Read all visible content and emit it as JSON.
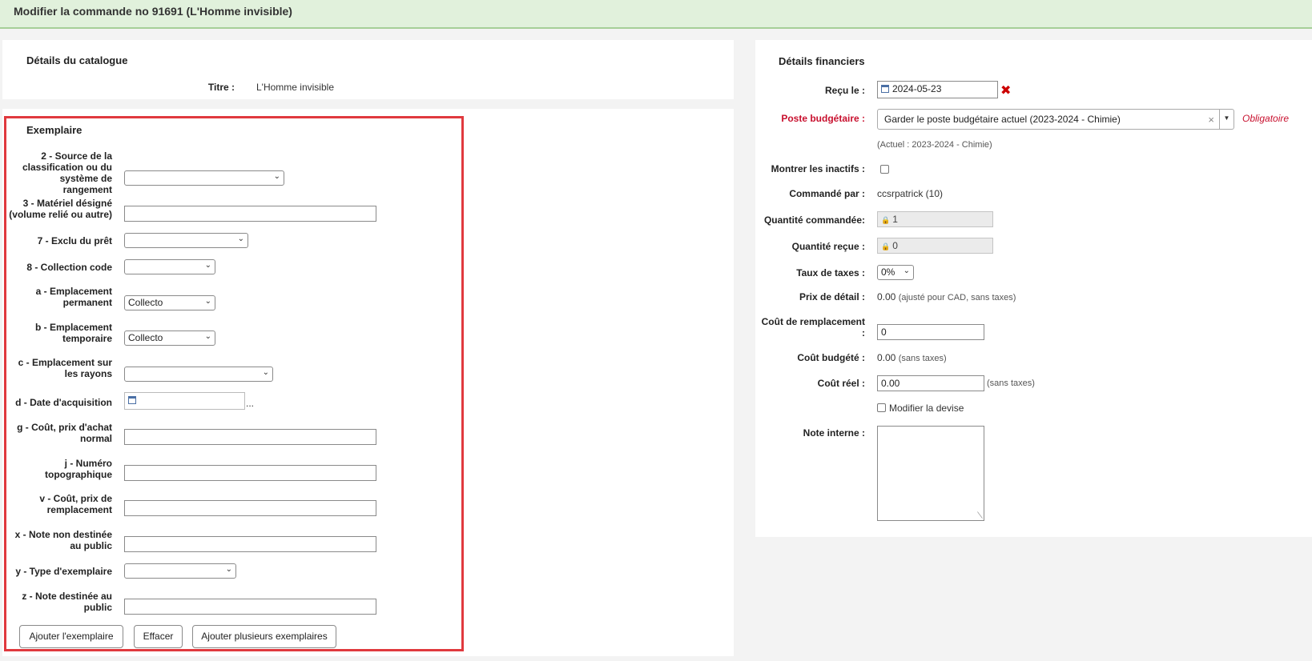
{
  "header": {
    "title": "Modifier la commande no 91691 (L'Homme invisible)"
  },
  "catalog": {
    "heading": "Détails du catalogue",
    "title_label": "Titre :",
    "title_value": "L'Homme invisible"
  },
  "item": {
    "heading": "Exemplaire",
    "fields": {
      "f2": {
        "label": "2 - Source de la classification ou du système de rangement",
        "value": ""
      },
      "f3": {
        "label": "3 - Matériel désigné (volume relié ou autre)",
        "value": ""
      },
      "f7": {
        "label": "7 - Exclu du prêt",
        "value": ""
      },
      "f8": {
        "label": "8 - Collection code",
        "value": ""
      },
      "fa": {
        "label": "a - Emplacement permanent",
        "value": "Collecto"
      },
      "fb": {
        "label": "b - Emplacement temporaire",
        "value": "Collecto"
      },
      "fc": {
        "label": "c - Emplacement sur les rayons",
        "value": ""
      },
      "fd": {
        "label": "d - Date d'acquisition",
        "value": "",
        "ellipsis": "..."
      },
      "fg": {
        "label": "g - Coût, prix d'achat normal",
        "value": ""
      },
      "fj": {
        "label": "j - Numéro topographique",
        "value": ""
      },
      "fv": {
        "label": "v - Coût, prix de remplacement",
        "value": ""
      },
      "fx": {
        "label": "x - Note non destinée au public",
        "value": ""
      },
      "fy": {
        "label": "y - Type d'exemplaire",
        "value": ""
      },
      "fz": {
        "label": "z - Note destinée au public",
        "value": ""
      }
    },
    "buttons": {
      "add": "Ajouter l'exemplaire",
      "clear": "Effacer",
      "add_multiple": "Ajouter plusieurs exemplaires"
    }
  },
  "financial": {
    "heading": "Détails financiers",
    "received_label": "Reçu le :",
    "received_value": "2024-05-23",
    "budget_label": "Poste budgétaire :",
    "budget_value": "Garder le poste budgétaire actuel (2023-2024 - Chimie)",
    "budget_required": "Obligatoire",
    "budget_current": "(Actuel : 2023-2024 - Chimie)",
    "show_inactive_label": "Montrer les inactifs :",
    "ordered_by_label": "Commandé par :",
    "ordered_by_value": "ccsrpatrick (10)",
    "qty_ordered_label": "Quantité commandée:",
    "qty_ordered_value": "1",
    "qty_received_label": "Quantité reçue :",
    "qty_received_value": "0",
    "tax_label": "Taux de taxes :",
    "tax_value": "0%",
    "retail_label": "Prix de détail :",
    "retail_value": "0.00",
    "retail_note": "(ajusté pour CAD, sans taxes)",
    "replacement_label": "Coût de remplacement :",
    "replacement_value": "0",
    "budgeted_label": "Coût budgété :",
    "budgeted_value": "0.00",
    "budgeted_note": "(sans taxes)",
    "actual_label": "Coût réel :",
    "actual_value": "0.00",
    "actual_note": "(sans taxes)",
    "change_currency_label": "Modifier la devise",
    "internal_note_label": "Note interne :"
  },
  "colors": {
    "header_bg": "#e1f1dc",
    "highlight_border": "#e0393e",
    "required": "#c8102e",
    "remove": "#cc0000"
  }
}
